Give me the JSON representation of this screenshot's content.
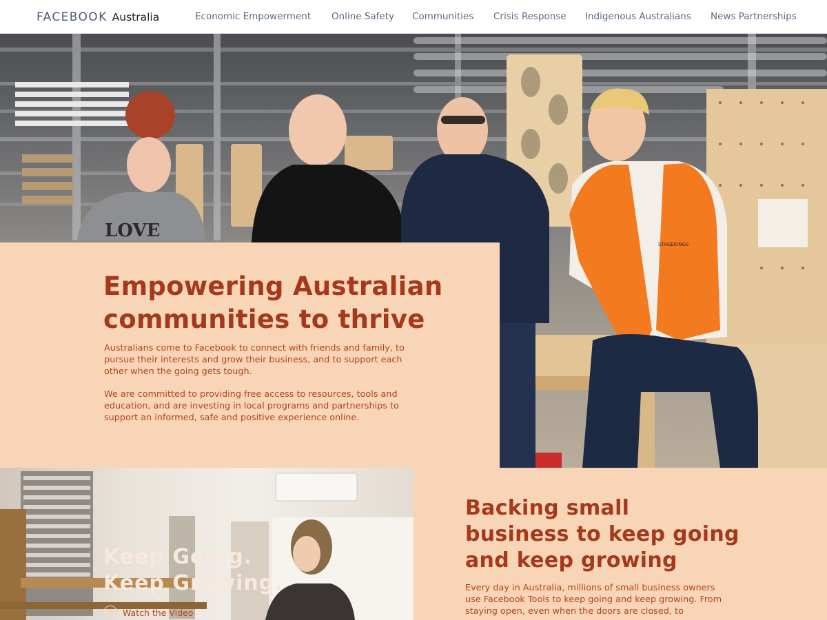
{
  "header": {
    "brand_primary": "FACEBOOK",
    "brand_secondary": "Australia",
    "nav": [
      {
        "label": "Economic Empowerment"
      },
      {
        "label": "Online Safety"
      },
      {
        "label": "Communities"
      },
      {
        "label": "Crisis Response"
      },
      {
        "label": "Indigenous Australians"
      },
      {
        "label": "News Partnerships"
      }
    ]
  },
  "hero": {
    "title_line1": "Empowering Australian",
    "title_line2": "communities to thrive",
    "paragraph1": "Australians come to Facebook to connect with friends and family, to pursue their interests and grow their business, and to support each other when the going gets tough.",
    "paragraph2": "We are committed to providing free access to resources, tools and education, and are investing in local programs and partnerships to support an informed, safe and positive experience online.",
    "photo_shirt_text": "LOVE",
    "photo_badge_text": "STAGEKINGS"
  },
  "small_business": {
    "video_title_line1": "Keep Going.",
    "video_title_line2": "Keep Growing.",
    "video_link": "Watch the Video",
    "title_line1": "Backing small",
    "title_line2": "business to keep going",
    "title_line3": "and keep growing",
    "paragraph": "Every day in Australia, millions of small business owners use Facebook Tools to keep going and keep growing. From staying open, even when the doors are closed, to"
  },
  "colors": {
    "page_background": "#f9d5b8",
    "accent_text": "#a4391c",
    "nav_text": "#5a6a82",
    "hi_vis_vest": "#f47a1f"
  }
}
